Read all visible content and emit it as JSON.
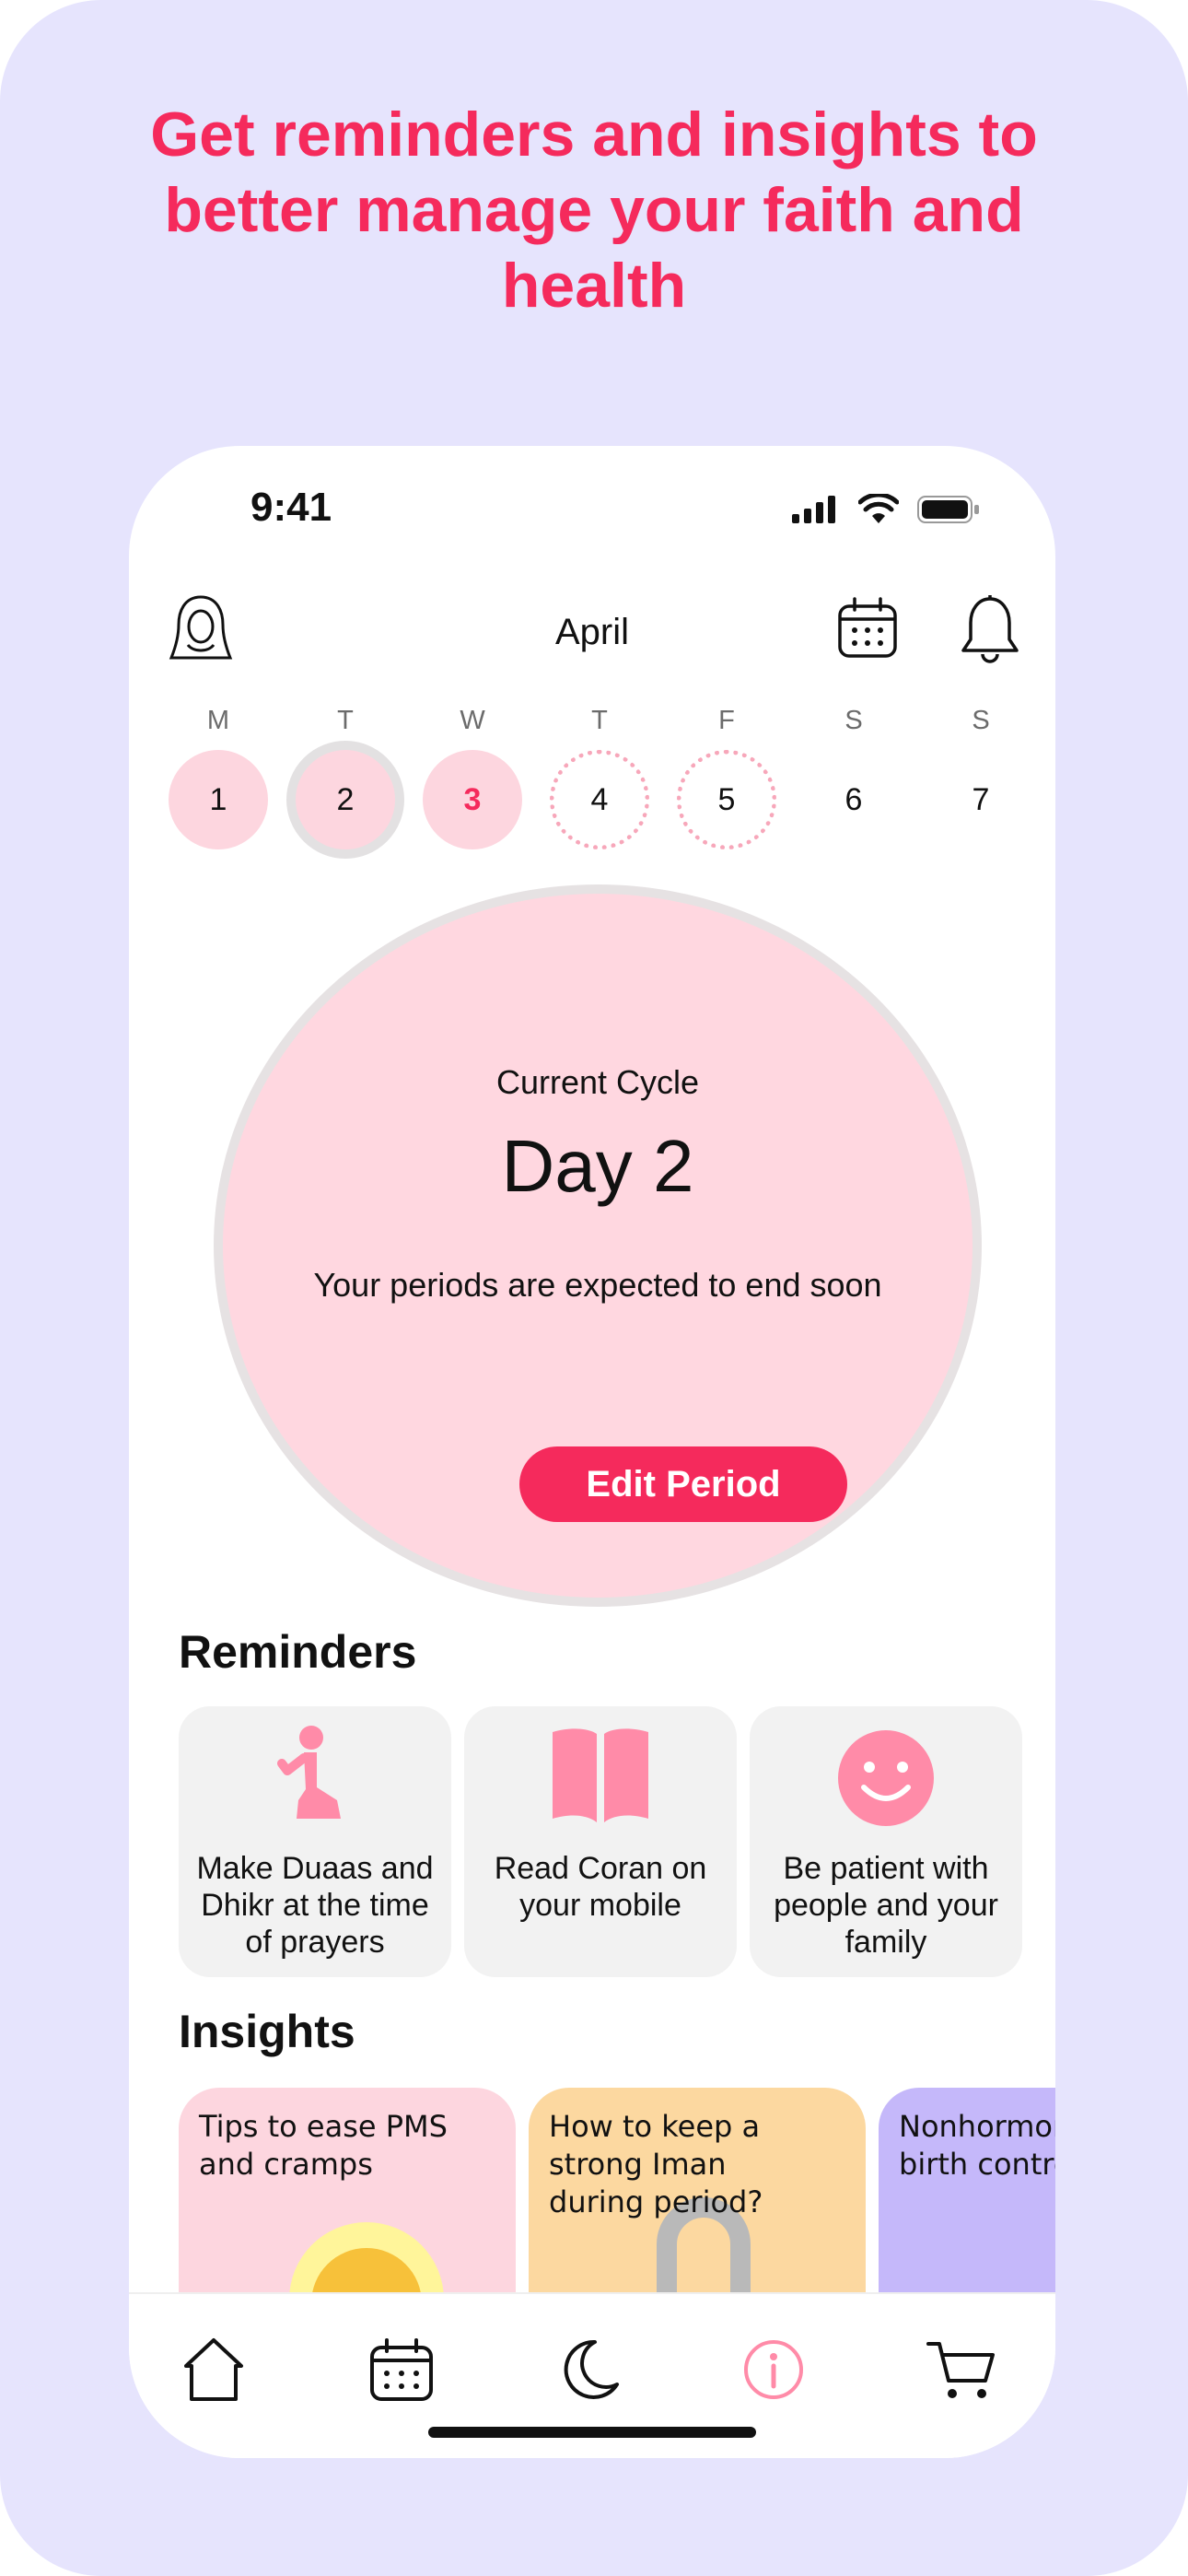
{
  "headline": "Get reminders and insights to better manage your faith and health",
  "status_bar": {
    "time": "9:41",
    "icons": [
      "signal-icon",
      "wifi-icon",
      "battery-icon"
    ]
  },
  "header": {
    "month": "April",
    "left_icon": "hijab-avatar-icon",
    "right_icons": [
      "calendar-icon",
      "bell-icon"
    ]
  },
  "week": {
    "weekdays": [
      "M",
      "T",
      "W",
      "T",
      "F",
      "S",
      "S"
    ],
    "days": [
      {
        "label": "1",
        "state": "period"
      },
      {
        "label": "2",
        "state": "today"
      },
      {
        "label": "3",
        "state": "selected"
      },
      {
        "label": "4",
        "state": "predicted"
      },
      {
        "label": "5",
        "state": "predicted"
      },
      {
        "label": "6",
        "state": "none"
      },
      {
        "label": "7",
        "state": "none"
      }
    ]
  },
  "cycle": {
    "label": "Current Cycle",
    "day": "Day 2",
    "note": "Your periods are expected to end soon",
    "button": "Edit Period"
  },
  "reminders": {
    "title": "Reminders",
    "items": [
      {
        "icon": "praying-person-icon",
        "text": "Make Duaas and Dhikr at the time of prayers"
      },
      {
        "icon": "open-book-icon",
        "text": "Read Coran on your mobile"
      },
      {
        "icon": "smiley-face-icon",
        "text": "Be patient with people and your family"
      }
    ]
  },
  "insights": {
    "title": "Insights",
    "items": [
      {
        "text": "Tips to ease PMS\nand cramps",
        "color": "#FDD6DF"
      },
      {
        "text": "How to keep a\nstrong Iman\nduring period?",
        "color": "#FCD8A0"
      },
      {
        "text": "Nonhormonal\nbirth control",
        "color": "#C5B8FA"
      }
    ]
  },
  "tabbar": {
    "items": [
      "home-icon",
      "calendar-icon",
      "moon-icon",
      "info-icon",
      "cart-icon"
    ],
    "active": "info-icon"
  },
  "colors": {
    "accent": "#F52A5C",
    "pink_light": "#FDD6DF",
    "background": "#E6E4FD"
  }
}
